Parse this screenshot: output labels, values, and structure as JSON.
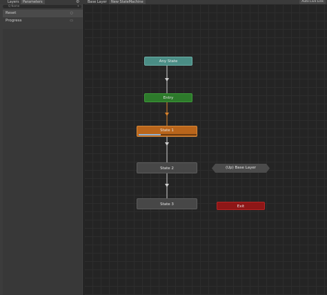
{
  "tabs": {
    "layers": "Layers",
    "parameters": "Parameters",
    "breadcrumb_base": "Base Layer",
    "breadcrumb_new": "New StateMachine",
    "auto_live_link": "Auto Live Link"
  },
  "left_panel": {
    "search_placeholder": "Q Name",
    "add_symbol": "+",
    "params": [
      {
        "name": "Reset",
        "icon": "trigger-icon",
        "symbol": "○",
        "selected": true
      },
      {
        "name": "Progress",
        "icon": "float-icon",
        "symbol": "▭",
        "selected": false
      }
    ]
  },
  "graph": {
    "nodes": {
      "any_state": "Any State",
      "entry": "Entry",
      "state1": "State 1",
      "state2": "State 2",
      "state3": "State 3",
      "up_base": "(Up) Base Layer",
      "exit": "Exit"
    },
    "state1_progress": 0.38,
    "colors": {
      "any_state": "#4a8d85",
      "entry": "#2d7a2b",
      "active_state": "#b9651b",
      "state": "#474747",
      "exit": "#8e1717",
      "transition": "#d0d0d0",
      "active_transition": "#d9822b"
    }
  }
}
